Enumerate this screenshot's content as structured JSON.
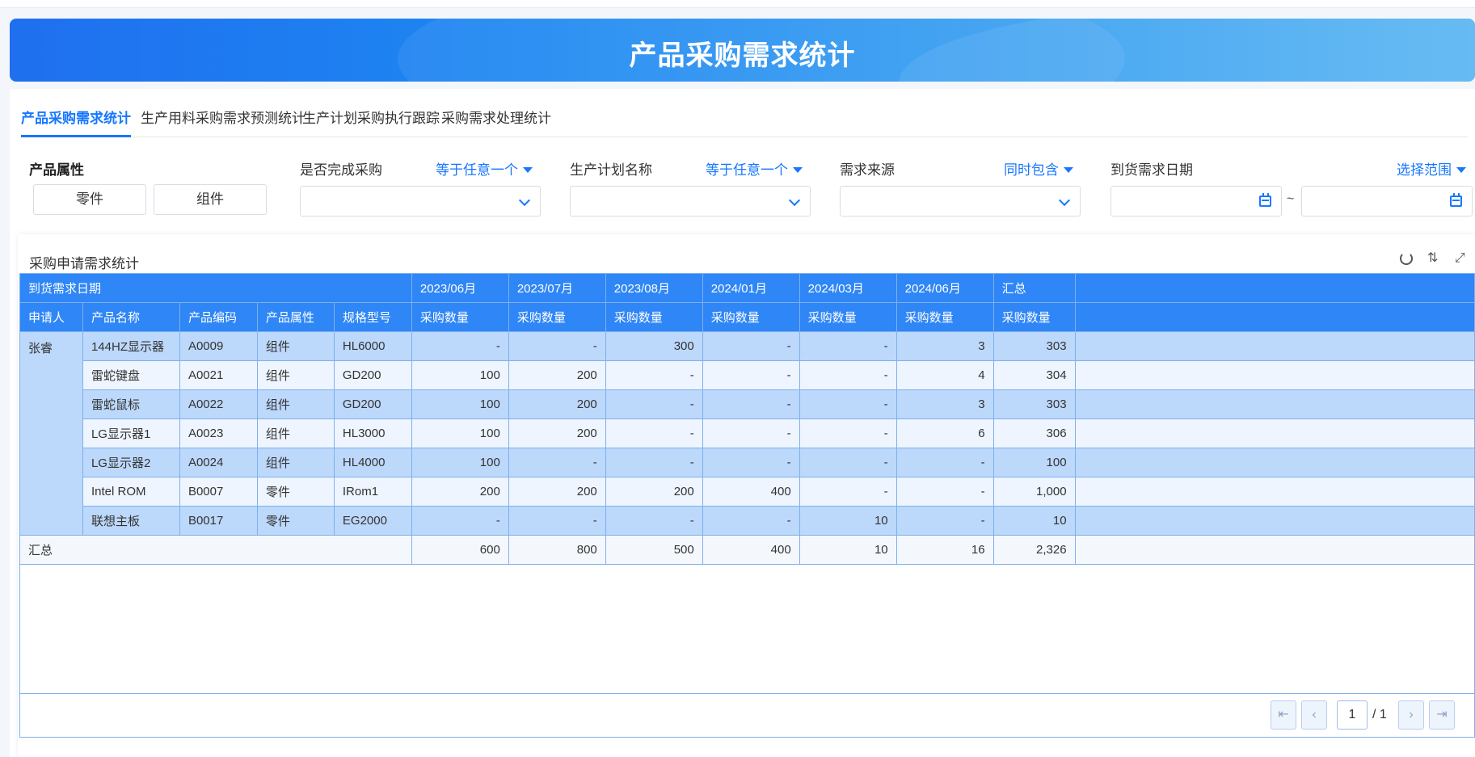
{
  "banner": {
    "title": "产品采购需求统计"
  },
  "tabs": [
    {
      "label": "产品采购需求统计",
      "active": true
    },
    {
      "label": "生产用料采购需求预测统计",
      "active": false
    },
    {
      "label": "生产计划采购执行跟踪",
      "active": false
    },
    {
      "label": "采购需求处理统计",
      "active": false
    }
  ],
  "filters": {
    "product_attr": {
      "label": "产品属性",
      "options": [
        "零件",
        "组件"
      ]
    },
    "purchase_done": {
      "label": "是否完成采购",
      "operator": "等于任意一个",
      "value": ""
    },
    "plan_name": {
      "label": "生产计划名称",
      "operator": "等于任意一个",
      "value": ""
    },
    "source": {
      "label": "需求来源",
      "operator": "同时包含",
      "value": ""
    },
    "arrival_date": {
      "label": "到货需求日期",
      "operator": "选择范围",
      "separator": "~",
      "start": "",
      "end": ""
    }
  },
  "report": {
    "title": "采购申请需求统计",
    "header_top": {
      "group_label": "到货需求日期",
      "periods": [
        "2023/06月",
        "2023/07月",
        "2023/08月",
        "2024/01月",
        "2024/03月",
        "2024/06月",
        "汇总"
      ]
    },
    "header_sub": {
      "cols": [
        "申请人",
        "产品名称",
        "产品编码",
        "产品属性",
        "规格型号"
      ],
      "measure": "采购数量"
    },
    "applicant": "张睿",
    "rows": [
      {
        "name": "144HZ显示器",
        "code": "A0009",
        "attr": "组件",
        "spec": "HL6000",
        "vals": [
          "-",
          "-",
          "300",
          "-",
          "-",
          "3",
          "303"
        ]
      },
      {
        "name": "雷蛇键盘",
        "code": "A0021",
        "attr": "组件",
        "spec": "GD200",
        "vals": [
          "100",
          "200",
          "-",
          "-",
          "-",
          "4",
          "304"
        ]
      },
      {
        "name": "雷蛇鼠标",
        "code": "A0022",
        "attr": "组件",
        "spec": "GD200",
        "vals": [
          "100",
          "200",
          "-",
          "-",
          "-",
          "3",
          "303"
        ]
      },
      {
        "name": "LG显示器1",
        "code": "A0023",
        "attr": "组件",
        "spec": "HL3000",
        "vals": [
          "100",
          "200",
          "-",
          "-",
          "-",
          "6",
          "306"
        ]
      },
      {
        "name": "LG显示器2",
        "code": "A0024",
        "attr": "组件",
        "spec": "HL4000",
        "vals": [
          "100",
          "-",
          "-",
          "-",
          "-",
          "-",
          "100"
        ]
      },
      {
        "name": "Intel ROM",
        "code": "B0007",
        "attr": "零件",
        "spec": "IRom1",
        "vals": [
          "200",
          "200",
          "200",
          "400",
          "-",
          "-",
          "1,000"
        ]
      },
      {
        "name": "联想主板",
        "code": "B0017",
        "attr": "零件",
        "spec": "EG2000",
        "vals": [
          "-",
          "-",
          "-",
          "-",
          "10",
          "-",
          "10"
        ]
      }
    ],
    "total": {
      "label": "汇总",
      "vals": [
        "600",
        "800",
        "500",
        "400",
        "10",
        "16",
        "2,326"
      ]
    }
  },
  "pager": {
    "current": "1",
    "total": "/ 1"
  },
  "colors": {
    "accent": "#1677ff",
    "header": "#2f86f6",
    "row_highlight": "#bcd8fb",
    "row_light": "#eef5fe"
  }
}
